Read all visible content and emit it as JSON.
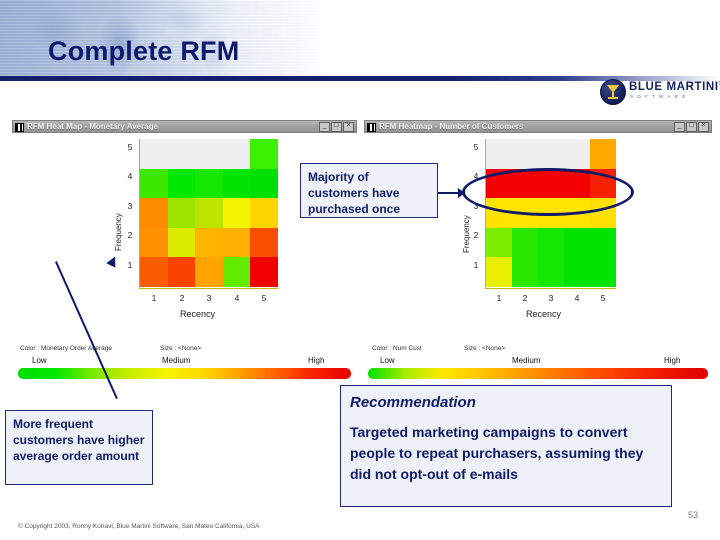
{
  "header": {
    "title": "Complete RFM",
    "logo_text": "BLUE MARTINI",
    "logo_tm": "®",
    "logo_sub": "SOFTWARE"
  },
  "left_window": {
    "title": "RFM Heat Map - Monetary Average",
    "buttons": {
      "minimize": "_",
      "maximize": "□",
      "close": "×"
    },
    "chart": {
      "xlabel": "Recency",
      "ylabel": "Frequency",
      "xticks": [
        "1",
        "2",
        "3",
        "4",
        "5"
      ],
      "yticks": [
        "1",
        "2",
        "3",
        "4",
        "5"
      ]
    },
    "legend": {
      "color_meta": "Color : Monetary Order Average",
      "size_meta": "Size : <None>",
      "low": "Low",
      "medium": "Medium",
      "high": "High",
      "gradient": [
        "#00e000",
        "#00e800",
        "#7ae800",
        "#c6ec00",
        "#f4f400",
        "#ffd800",
        "#ffa000",
        "#ff6000",
        "#f82000",
        "#e80000"
      ]
    }
  },
  "right_window": {
    "title": "RFM Heatmap - Number of Customers",
    "buttons": {
      "minimize": "_",
      "maximize": "□",
      "close": "×"
    },
    "chart": {
      "xlabel": "Recency",
      "ylabel": "Frequency",
      "xticks": [
        "1",
        "2",
        "3",
        "4",
        "5"
      ],
      "yticks": [
        "1",
        "2",
        "3",
        "4",
        "5"
      ]
    },
    "legend": {
      "color_meta": "Color : Num Cust",
      "size_meta": "Size : <None>",
      "low": "Low",
      "medium": "Medium",
      "high": "High",
      "gradient": [
        "#00e000",
        "#a8ec00",
        "#ffe800",
        "#ffc400",
        "#ffa000",
        "#ff7800",
        "#ff5000",
        "#f83000",
        "#ec1400",
        "#e00000"
      ]
    }
  },
  "callouts": {
    "majority": "Majority of customers have purchased once",
    "frequent": "More frequent customers have higher average order amount",
    "recommendation_title": "Recommendation",
    "recommendation_body": "Targeted marketing campaigns to convert people to repeat purchasers, assuming they did not opt-out of e-mails"
  },
  "footer": {
    "copyright": "© Copyright 2003, Ronny Kohavi, Blue Martini Software, San Mateo California, USA",
    "page": "53"
  },
  "chart_data": [
    {
      "type": "heatmap",
      "title": "RFM Heat Map - Monetary Average",
      "xlabel": "Recency",
      "ylabel": "Frequency",
      "x": [
        "1",
        "2",
        "3",
        "4",
        "5"
      ],
      "y": [
        "1",
        "2",
        "3",
        "4",
        "5"
      ],
      "color_metric": "Monetary Order Average",
      "size_metric": "<None>",
      "colorbar": {
        "low": "Low",
        "medium": "Medium",
        "high": "High"
      },
      "grid": "on",
      "legend_position": "bottom",
      "cells": [
        {
          "frequency": "5",
          "values": [
            null,
            null,
            null,
            null,
            "high-low"
          ],
          "colors": [
            "#f0f0f0",
            "#f0f0f0",
            "#f0f0f0",
            "#f0f0f0",
            "#3cf000"
          ]
        },
        {
          "frequency": "4",
          "values": [
            "low",
            "low",
            "low",
            "low",
            "low"
          ],
          "colors": [
            "#3ce800",
            "#00e800",
            "#14e800",
            "#00e400",
            "#00e000"
          ]
        },
        {
          "frequency": "3",
          "values": [
            "high",
            "low-med",
            "low-med",
            "medium",
            "med-high"
          ],
          "colors": [
            "#ff8c00",
            "#9ce400",
            "#bce400",
            "#f4f400",
            "#ffd400"
          ]
        },
        {
          "frequency": "2",
          "values": [
            "high",
            "low-med",
            "med-high",
            "med-high",
            "high"
          ],
          "colors": [
            "#ff9000",
            "#dcec00",
            "#ffb400",
            "#ffb000",
            "#f85000"
          ]
        },
        {
          "frequency": "1",
          "values": [
            "high",
            "high",
            "med-high",
            "low",
            "highest"
          ],
          "colors": [
            "#f85c00",
            "#f84400",
            "#ffa400",
            "#64ec00",
            "#f00000"
          ]
        }
      ]
    },
    {
      "type": "heatmap",
      "title": "RFM Heatmap - Number of Customers",
      "xlabel": "Recency",
      "ylabel": "Frequency",
      "x": [
        "1",
        "2",
        "3",
        "4",
        "5"
      ],
      "y": [
        "1",
        "2",
        "3",
        "4",
        "5"
      ],
      "color_metric": "Num Cust",
      "size_metric": "<None>",
      "colorbar": {
        "low": "Low",
        "medium": "Medium",
        "high": "High"
      },
      "grid": "on",
      "legend_position": "bottom",
      "annotation": "Majority of customers have purchased once",
      "cells": [
        {
          "frequency": "5",
          "values": [
            null,
            null,
            null,
            null,
            "med-high"
          ],
          "colors": [
            "#f0f0f0",
            "#f0f0f0",
            "#f0f0f0",
            "#f0f0f0",
            "#ffa800"
          ]
        },
        {
          "frequency": "4",
          "values": [
            "highest",
            "highest",
            "highest",
            "highest",
            "highest"
          ],
          "colors": [
            "#f40000",
            "#f40000",
            "#f40000",
            "#f40000",
            "#f82000"
          ]
        },
        {
          "frequency": "3",
          "values": [
            "medium",
            "medium",
            "medium",
            "medium",
            "medium"
          ],
          "colors": [
            "#ffe400",
            "#ffe400",
            "#ffe400",
            "#ffe400",
            "#ffe000"
          ]
        },
        {
          "frequency": "2",
          "values": [
            "low",
            "low",
            "low",
            "low",
            "low"
          ],
          "colors": [
            "#7cec00",
            "#28e800",
            "#14e800",
            "#00e400",
            "#00e400"
          ]
        },
        {
          "frequency": "1",
          "values": [
            "low",
            "low",
            "low",
            "low",
            "low"
          ],
          "colors": [
            "#e8f000",
            "#28e800",
            "#14e800",
            "#00e400",
            "#00e400"
          ]
        }
      ]
    }
  ]
}
